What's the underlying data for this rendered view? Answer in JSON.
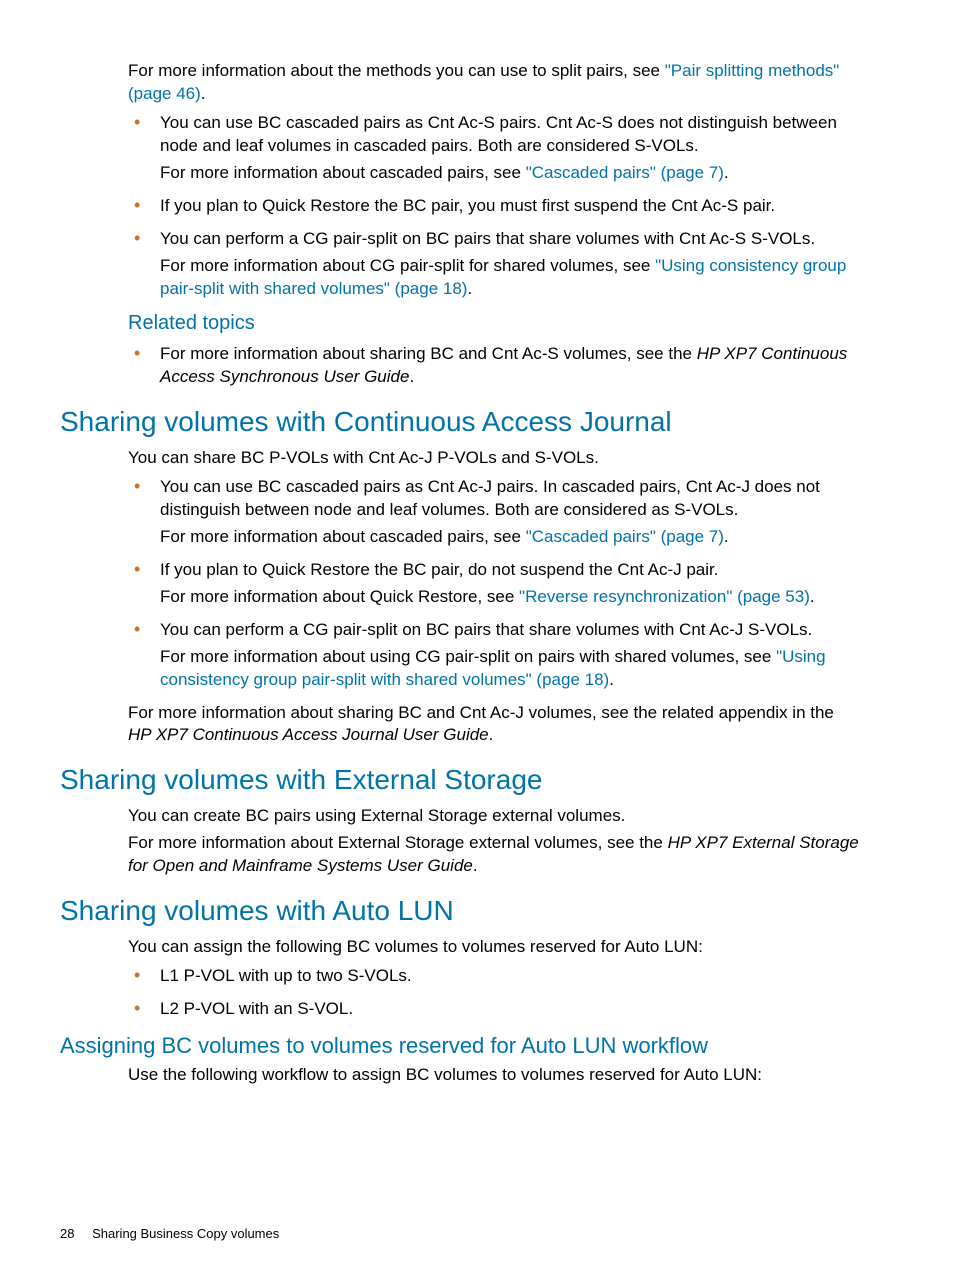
{
  "intro": {
    "p1a": "For more information about the methods you can use to split pairs, see ",
    "link1": "\"Pair splitting methods\" (page 46)",
    "p1b": "."
  },
  "topList": {
    "li1p1": "You can use BC cascaded pairs as Cnt Ac-S pairs. Cnt Ac-S does not distinguish between node and leaf volumes in cascaded pairs. Both are considered S-VOLs.",
    "li1p2a": "For more information about cascaded pairs, see ",
    "li1link": "\"Cascaded pairs\" (page 7)",
    "li1p2b": ".",
    "li2p1": "If you plan to Quick Restore the BC pair, you must first suspend the Cnt Ac-S pair.",
    "li3p1": "You can perform a CG pair-split on BC pairs that share volumes with Cnt Ac-S S-VOLs.",
    "li3p2a": "For more information about CG pair-split for shared volumes, see ",
    "li3link": "\"Using consistency group pair-split with shared volumes\" (page 18)",
    "li3p2b": "."
  },
  "related": {
    "heading": "Related topics",
    "li1a": "For more information about sharing BC and Cnt Ac-S volumes, see the ",
    "li1i": "HP XP7 Continuous Access Synchronous User Guide",
    "li1b": "."
  },
  "caj": {
    "heading": "Sharing volumes with Continuous Access Journal",
    "p1": "You can share BC P-VOLs with Cnt Ac-J P-VOLs and S-VOLs.",
    "li1p1": "You can use BC cascaded pairs as Cnt Ac-J pairs. In cascaded pairs, Cnt Ac-J does not distinguish between node and leaf volumes. Both are considered as S-VOLs.",
    "li1p2a": "For more information about cascaded pairs, see ",
    "li1link": "\"Cascaded pairs\" (page 7)",
    "li1p2b": ".",
    "li2p1": "If you plan to Quick Restore the BC pair, do not suspend the Cnt Ac-J pair.",
    "li2p2a": "For more information about Quick Restore, see ",
    "li2link": "\"Reverse resynchronization\" (page 53)",
    "li2p2b": ".",
    "li3p1": "You can perform a CG pair-split on BC pairs that share volumes with Cnt Ac-J S-VOLs.",
    "li3p2a": "For more information about using CG pair-split on pairs with shared volumes, see ",
    "li3link": "\"Using consistency group pair-split with shared volumes\" (page 18)",
    "li3p2b": ".",
    "p2a": "For more information about sharing BC and Cnt Ac-J volumes, see the related appendix in the ",
    "p2i": "HP XP7 Continuous Access Journal User Guide",
    "p2b": "."
  },
  "ext": {
    "heading": "Sharing volumes with External Storage",
    "p1": "You can create BC pairs using External Storage external volumes.",
    "p2a": "For more information about External Storage external volumes, see the ",
    "p2i": "HP XP7 External Storage for Open and Mainframe Systems User Guide",
    "p2b": "."
  },
  "autolun": {
    "heading": "Sharing volumes with Auto LUN",
    "p1": "You can assign the following BC volumes to volumes reserved for Auto LUN:",
    "li1": "L1 P-VOL with up to two S-VOLs.",
    "li2": "L2 P-VOL with an S-VOL."
  },
  "workflow": {
    "heading": "Assigning BC volumes to volumes reserved for Auto LUN workflow",
    "p1": "Use the following workflow to assign BC volumes to volumes reserved for Auto LUN:"
  },
  "footer": {
    "page": "28",
    "title": "Sharing Business Copy volumes"
  }
}
